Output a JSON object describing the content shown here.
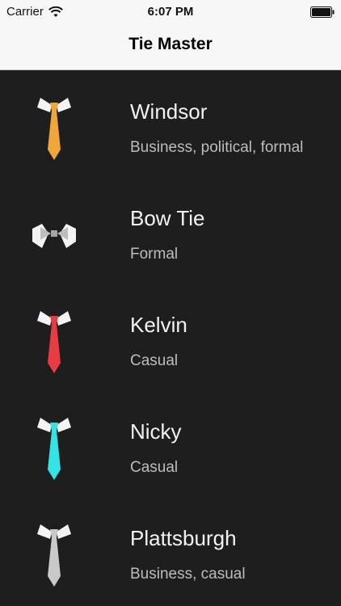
{
  "status_bar": {
    "carrier": "Carrier",
    "time": "6:07 PM"
  },
  "nav": {
    "title": "Tie Master"
  },
  "ties": [
    {
      "name": "Windsor",
      "description": "Business, political, formal",
      "icon": "windsor-tie-icon",
      "color": "#f0a63a"
    },
    {
      "name": "Bow Tie",
      "description": "Formal",
      "icon": "bow-tie-icon",
      "color": "#bdbdbd"
    },
    {
      "name": "Kelvin",
      "description": "Casual",
      "icon": "kelvin-tie-icon",
      "color": "#e83b43"
    },
    {
      "name": "Nicky",
      "description": "Casual",
      "icon": "nicky-tie-icon",
      "color": "#34e3e3"
    },
    {
      "name": "Plattsburgh",
      "description": "Business, casual",
      "icon": "plattsburgh-tie-icon",
      "color": "#c9c9c9"
    }
  ]
}
